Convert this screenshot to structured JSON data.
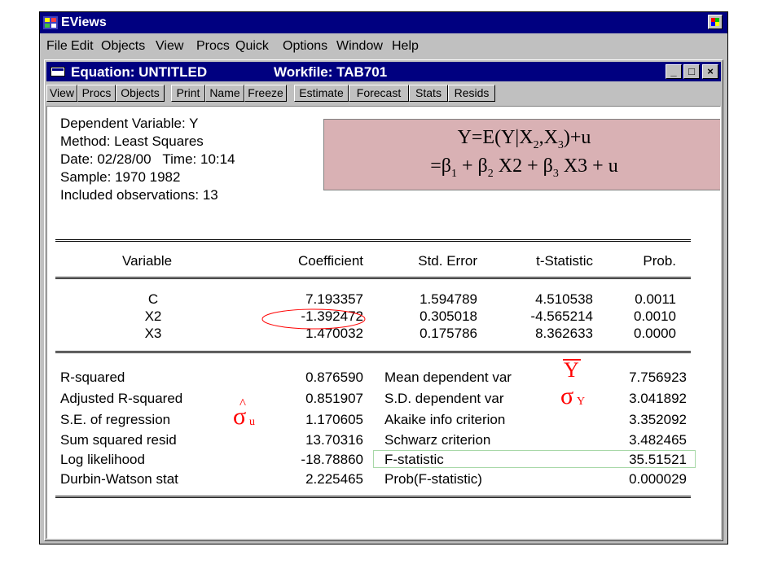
{
  "app": {
    "title": "EViews",
    "menu": [
      "File",
      "Edit",
      "Objects",
      "View",
      "Procs",
      "Quick",
      "Options",
      "Window",
      "Help"
    ]
  },
  "doc": {
    "title": "Equation: UNTITLED",
    "workfile": "Workfile: TAB701",
    "controls": [
      "_",
      "□",
      "×"
    ]
  },
  "toolbar": [
    "View",
    "Procs",
    "Objects",
    "Print",
    "Name",
    "Freeze",
    "Estimate",
    "Forecast",
    "Stats",
    "Resids"
  ],
  "header": {
    "dependent": "Dependent Variable: Y",
    "method": "Method: Least Squares",
    "date": "Date: 02/28/00   Time: 10:14",
    "sample": "Sample: 1970 1982",
    "obs": "Included observations: 13"
  },
  "equation": {
    "line1": "Y=E(Y|X",
    "line1_s1": "2",
    "line1_m": ",X",
    "line1_s2": "3",
    "line1_e": ")+u",
    "line2": "=β",
    "s1": "1",
    "p1": " + β",
    "s2": "2",
    "p2": " X2 + β",
    "s3": "3",
    "p3": " X3 + u"
  },
  "table": {
    "columns": [
      "Variable",
      "Coefficient",
      "Std. Error",
      "t-Statistic",
      "Prob."
    ],
    "rows": [
      [
        "C",
        "7.193357",
        "1.594789",
        "4.510538",
        "0.0011"
      ],
      [
        "X2",
        "-1.392472",
        "0.305018",
        "-4.565214",
        "0.0010"
      ],
      [
        "X3",
        "1.470032",
        "0.175786",
        "8.362633",
        "0.0000"
      ]
    ]
  },
  "stats": {
    "left": [
      [
        "R-squared",
        "0.876590"
      ],
      [
        "Adjusted R-squared",
        "0.851907"
      ],
      [
        "S.E. of regression",
        "1.170605"
      ],
      [
        "Sum squared resid",
        "13.70316"
      ],
      [
        "Log likelihood",
        "-18.78860"
      ],
      [
        "Durbin-Watson stat",
        "2.225465"
      ]
    ],
    "right": [
      [
        "Mean dependent var",
        "7.756923"
      ],
      [
        "S.D. dependent var",
        "3.041892"
      ],
      [
        "Akaike info criterion",
        "3.352092"
      ],
      [
        "Schwarz criterion",
        "3.482465"
      ],
      [
        "F-statistic",
        "35.51521"
      ],
      [
        "Prob(F-statistic)",
        "0.000029"
      ]
    ]
  },
  "annotations": {
    "ybar": "Y",
    "sigma": "σ",
    "sigma_y_sub": "Y",
    "hat": "^",
    "sigma_u_sub": "u"
  },
  "colors": {
    "titlebar": "#000080",
    "face": "#c0c0c0",
    "eq_box": "#d9b1b4",
    "annotation": "#ff0000",
    "highlight": "#a8d8a8"
  }
}
